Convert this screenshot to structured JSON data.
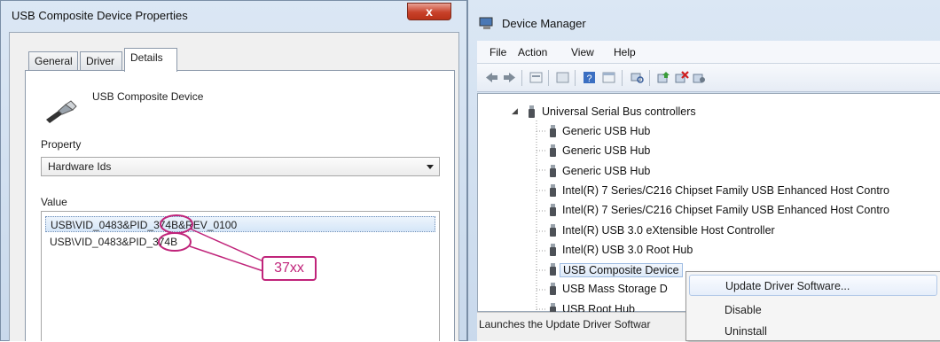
{
  "props_window": {
    "title": "USB Composite Device Properties",
    "close_glyph": "x",
    "tabs": [
      "General",
      "Driver",
      "Details"
    ],
    "device_name": "USB Composite Device",
    "property_label": "Property",
    "property_value": "Hardware Ids",
    "value_label": "Value",
    "values": [
      "USB\\VID_0483&PID_374B&REV_0100",
      "USB\\VID_0483&PID_374B"
    ]
  },
  "annotation": {
    "callout_text": "37xx",
    "color": "#c0247a"
  },
  "device_manager": {
    "title": "Device Manager",
    "menu": [
      "File",
      "Action",
      "View",
      "Help"
    ],
    "tree": {
      "category": "Universal Serial Bus controllers",
      "items": [
        "Generic USB Hub",
        "Generic USB Hub",
        "Generic USB Hub",
        "Intel(R) 7 Series/C216 Chipset Family USB Enhanced Host Contro",
        "Intel(R) 7 Series/C216 Chipset Family USB Enhanced Host Contro",
        "Intel(R) USB 3.0 eXtensible Host Controller",
        "Intel(R) USB 3.0 Root Hub",
        "USB Composite Device",
        "USB Mass Storage D",
        "USB Root Hub"
      ],
      "selected_index": 7
    },
    "status_text": "Launches the Update Driver Softwar",
    "context_menu": [
      "Update Driver Software...",
      "Disable",
      "Uninstall"
    ],
    "toolbar_icons": [
      "back-icon",
      "forward-icon",
      "properties-icon",
      "console-icon",
      "help-icon",
      "view-icon",
      "scan-icon",
      "update-driver-icon",
      "uninstall-icon",
      "disable-icon"
    ]
  }
}
